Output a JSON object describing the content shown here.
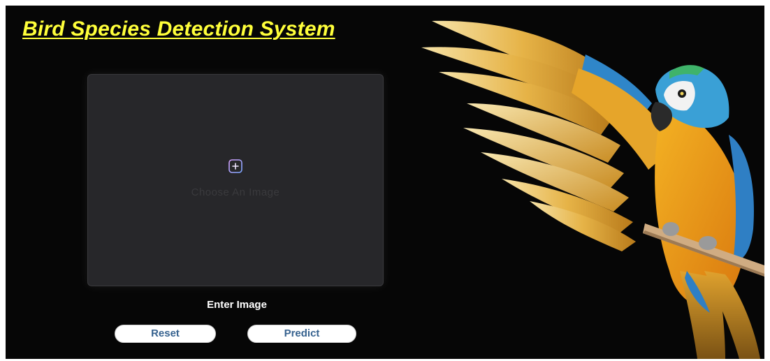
{
  "header": {
    "title": "Bird Species Detection System",
    "title_color": "#ffff3a"
  },
  "upload": {
    "icon": "add-image-icon",
    "placeholder": "Choose An Image",
    "label": "Enter Image"
  },
  "actions": {
    "reset_label": "Reset",
    "predict_label": "Predict"
  },
  "hero_image": {
    "subject": "parrot-illustration"
  },
  "colors": {
    "background": "#060606",
    "panel": "#27272a",
    "button_text": "#36628f"
  }
}
